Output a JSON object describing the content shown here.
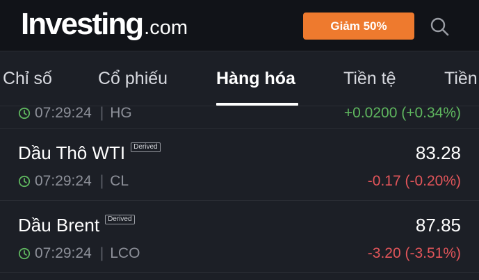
{
  "header": {
    "logo_main": "Investing",
    "logo_suffix": ".com",
    "promo_label": "Giảm 50%",
    "search_icon": "search-icon"
  },
  "tabs": [
    {
      "label": "Chỉ số"
    },
    {
      "label": "Cổ phiếu"
    },
    {
      "label": "Hàng hóa",
      "active": true
    },
    {
      "label": "Tiền tệ"
    },
    {
      "label": "Tiền"
    }
  ],
  "rows": [
    {
      "name": "",
      "time": "07:29:24",
      "symbol": "HG",
      "price": "",
      "change": "+0.0200 (+0.34%)",
      "direction": "up"
    },
    {
      "name": "Dầu Thô WTI",
      "badge": "Derived",
      "time": "07:29:24",
      "symbol": "CL",
      "price": "83.28",
      "change": "-0.17 (-0.20%)",
      "direction": "down"
    },
    {
      "name": "Dầu Brent",
      "badge": "Derived",
      "time": "07:29:24",
      "symbol": "LCO",
      "price": "87.85",
      "change": "-3.20 (-3.51%)",
      "direction": "down"
    }
  ],
  "colors": {
    "accent": "#ee7a2e",
    "positive": "#5fb75f",
    "negative": "#e2555a",
    "clock": "#5fb75f"
  }
}
